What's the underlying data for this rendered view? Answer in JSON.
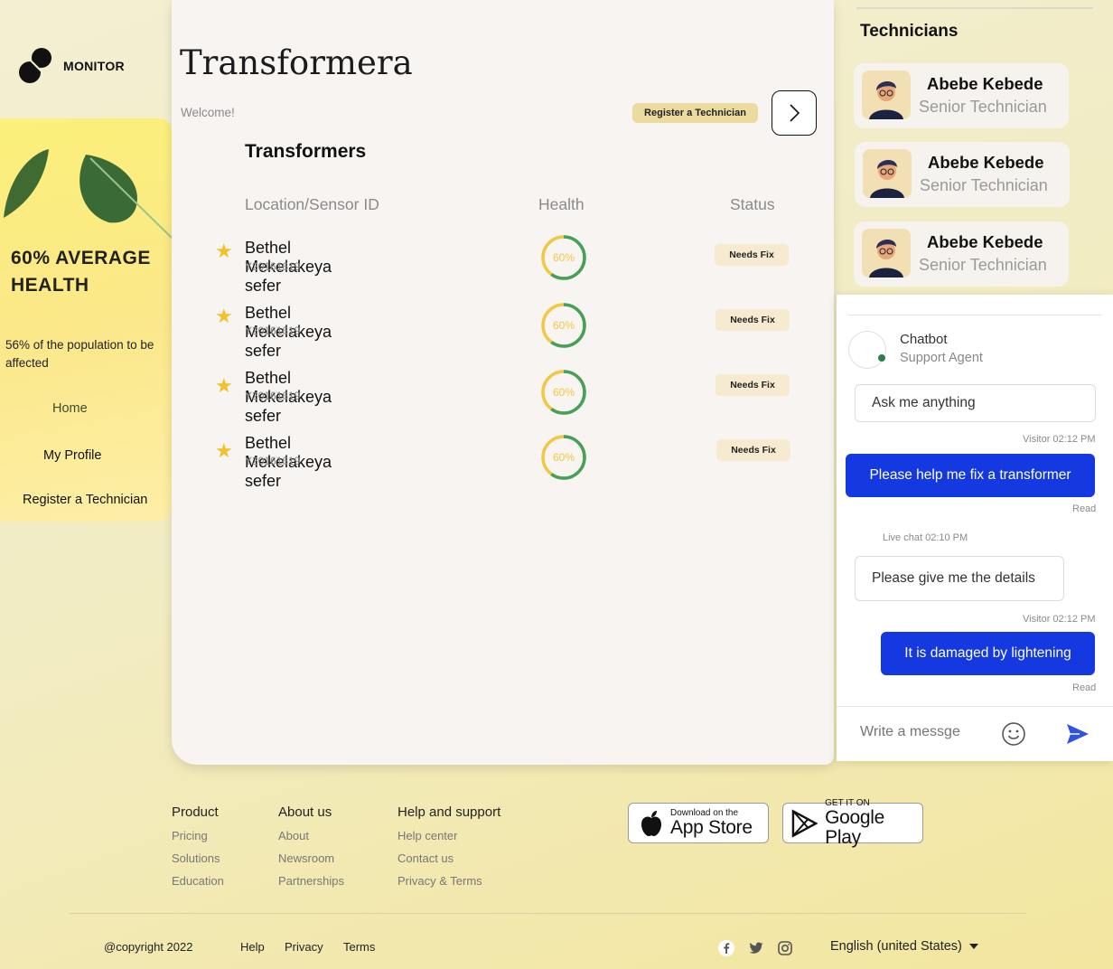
{
  "brand": {
    "name": "MONITOR",
    "icon": "monitor-logo-icon"
  },
  "sidebar": {
    "headline": "60% AVERAGE HEALTH",
    "subtext": "56% of the population to be affected",
    "nav": [
      {
        "label": "Home"
      },
      {
        "label": "My Profile"
      },
      {
        "label": "Register a Technician"
      }
    ]
  },
  "header": {
    "title": "Transformera",
    "welcome": "Welcome!",
    "register_button": "Register a Technician",
    "next_icon": "chevron-right-icon"
  },
  "transformers": {
    "title": "Transformers",
    "columns": [
      "Location/Sensor ID",
      "Health",
      "Status"
    ],
    "rows": [
      {
        "name": "Bethel Mekelakeya sefer",
        "id": "Y20161619",
        "health": "60%",
        "health_value": 0.6,
        "status": "Needs Fix"
      },
      {
        "name": "Bethel Mekelakeya sefer",
        "id": "Y20161619",
        "health": "60%",
        "health_value": 0.6,
        "status": "Needs Fix"
      },
      {
        "name": "Bethel Mekelakeya sefer",
        "id": "Y20161619",
        "health": "60%",
        "health_value": 0.6,
        "status": "Needs Fix"
      },
      {
        "name": "Bethel Mekelakeya sefer",
        "id": "Y20161619",
        "health": "60%",
        "health_value": 0.6,
        "status": "Needs Fix"
      }
    ]
  },
  "technicians": {
    "title": "Technicians",
    "items": [
      {
        "name": "Abebe Kebede",
        "role": "Senior Technician"
      },
      {
        "name": "Abebe Kebede",
        "role": "Senior Technician"
      },
      {
        "name": "Abebe Kebede",
        "role": "Senior Technician"
      }
    ]
  },
  "chat": {
    "bot_name": "Chatbot",
    "bot_role": "Support Agent",
    "messages": [
      {
        "text": "Ask me anything"
      },
      {
        "meta": "Visitor 02:12 PM",
        "text": "Please help me fix a transformer",
        "status": "Read"
      },
      {
        "meta": "Live chat 02:10 PM",
        "text": "Please give me the details"
      },
      {
        "meta": "Visitor 02:12 PM",
        "text": "It is damaged by lightening",
        "status": "Read"
      }
    ],
    "input_placeholder": "Write a messge",
    "emoji_icon": "smiley-icon",
    "send_icon": "send-icon",
    "accent_color": "#1439e0"
  },
  "footer": {
    "columns": [
      {
        "title": "Product",
        "links": [
          "Pricing",
          "Solutions",
          "Education"
        ]
      },
      {
        "title": "About us",
        "links": [
          "About",
          "Newsroom",
          "Partnerships"
        ]
      },
      {
        "title": "Help and support",
        "links": [
          "Help center",
          "Contact us",
          "Privacy & Terms"
        ]
      }
    ],
    "app_store": {
      "small": "Download on the",
      "big": "App Store"
    },
    "google_play": {
      "small": "GET IT ON",
      "big": "Google Play"
    },
    "copyright": "@copyright 2022",
    "bottom_links": [
      "Help",
      "Privacy",
      "Terms"
    ],
    "language": "English (united States)"
  }
}
